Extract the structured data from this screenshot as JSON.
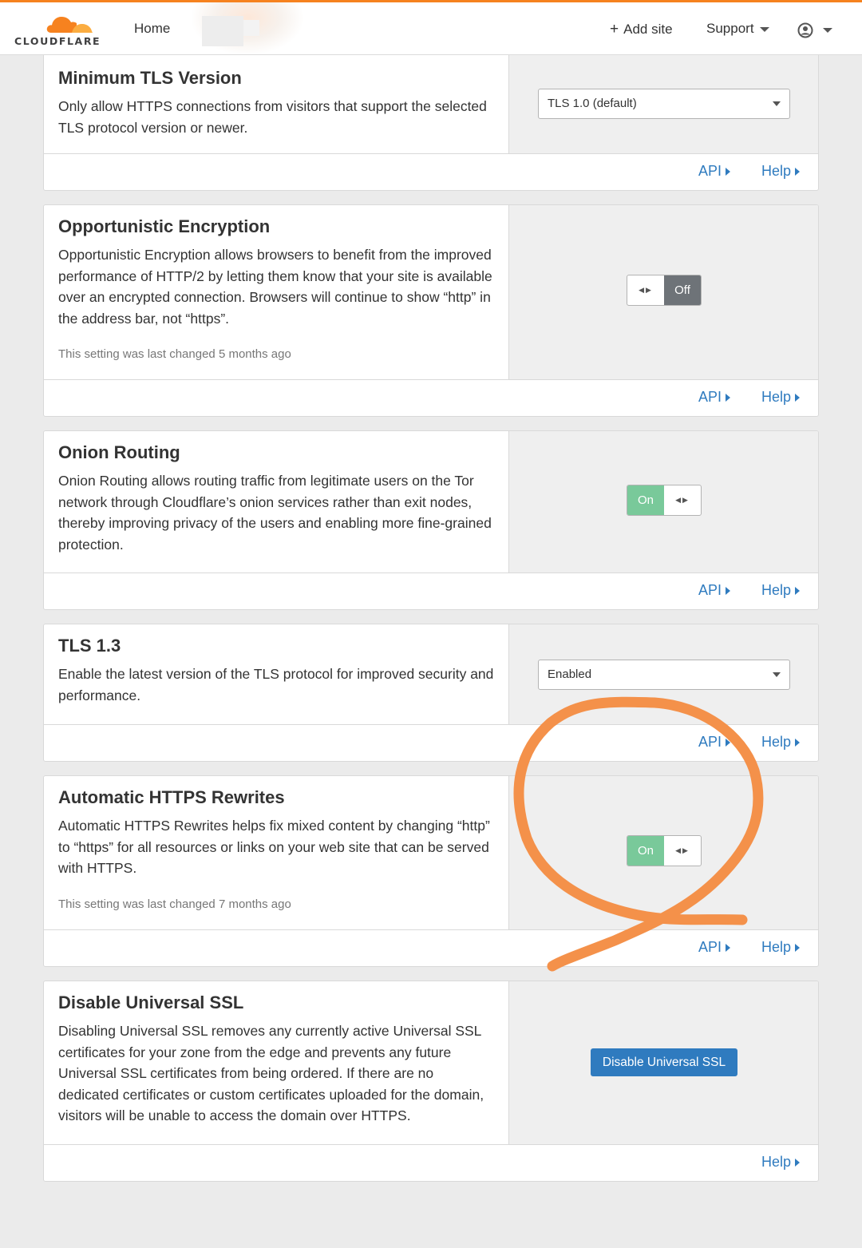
{
  "nav": {
    "brand": "CLOUDFLARE",
    "home": "Home",
    "add_site": "Add site",
    "support": "Support",
    "user_icon": "user-circle-icon",
    "brand_color": "#f6821f"
  },
  "cards": [
    {
      "title": "Minimum TLS Version",
      "description": "Only allow HTTPS connections from visitors that support the selected TLS protocol version or newer.",
      "control": {
        "type": "select",
        "value": "TLS 1.0 (default)"
      },
      "api": "API",
      "help": "Help"
    },
    {
      "title": "Opportunistic Encryption",
      "description": "Opportunistic Encryption allows browsers to benefit from the improved performance of HTTP/2 by letting them know that your site is available over an encrypted connection. Browsers will continue to show “http” in the address bar, not “https”.",
      "meta": "This setting was last changed 5 months ago",
      "control": {
        "type": "toggle",
        "state": "Off"
      },
      "api": "API",
      "help": "Help"
    },
    {
      "title": "Onion Routing",
      "description": "Onion Routing allows routing traffic from legitimate users on the Tor network through Cloudflare’s onion services rather than exit nodes, thereby improving privacy of the users and enabling more fine-grained protection.",
      "control": {
        "type": "toggle",
        "state": "On"
      },
      "api": "API",
      "help": "Help"
    },
    {
      "title": "TLS 1.3",
      "description": "Enable the latest version of the TLS protocol for improved security and performance.",
      "control": {
        "type": "select",
        "value": "Enabled"
      },
      "api": "API",
      "help": "Help"
    },
    {
      "title": "Automatic HTTPS Rewrites",
      "description": "Automatic HTTPS Rewrites helps fix mixed content by changing “http” to “https” for all resources or links on your web site that can be served with HTTPS.",
      "meta": "This setting was last changed 7 months ago",
      "control": {
        "type": "toggle",
        "state": "On"
      },
      "api": "API",
      "help": "Help"
    },
    {
      "title": "Disable Universal SSL",
      "description": "Disabling Universal SSL removes any currently active Universal SSL certificates for your zone from the edge and prevents any future Universal SSL certificates from being ordered. If there are no dedicated certificates or custom certificates uploaded for the domain, visitors will be unable to access the domain over HTTPS.",
      "control": {
        "type": "button",
        "label": "Disable Universal SSL"
      },
      "help": "Help"
    }
  ],
  "colors": {
    "link": "#2f7bbf",
    "toggle_on": "#79c99a",
    "toggle_off": "#6e7378",
    "annotation": "#f4914a"
  }
}
